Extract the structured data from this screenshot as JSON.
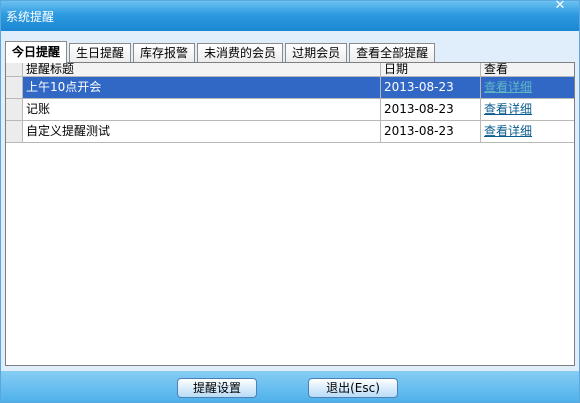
{
  "window": {
    "title": "系统提醒",
    "close_label": "✕"
  },
  "tabs": [
    {
      "label": "今日提醒",
      "active": true
    },
    {
      "label": "生日提醒"
    },
    {
      "label": "库存报警"
    },
    {
      "label": "未消费的会员"
    },
    {
      "label": "过期会员"
    },
    {
      "label": "查看全部提醒"
    }
  ],
  "table": {
    "headers": {
      "title": "提醒标题",
      "date": "日期",
      "view": "查看"
    },
    "rows": [
      {
        "title": "上午10点开会",
        "date": "2013-08-23",
        "view": "查看详细",
        "selected": true
      },
      {
        "title": "记账",
        "date": "2013-08-23",
        "view": "查看详细"
      },
      {
        "title": "自定义提醒测试",
        "date": "2013-08-23",
        "view": "查看详细"
      }
    ]
  },
  "footer": {
    "settings_label": "提醒设置",
    "exit_label": "退出(Esc)"
  },
  "colors": {
    "titlebar": "#2d9be0",
    "selection": "#3168c6",
    "link": "#0a5c8e"
  }
}
